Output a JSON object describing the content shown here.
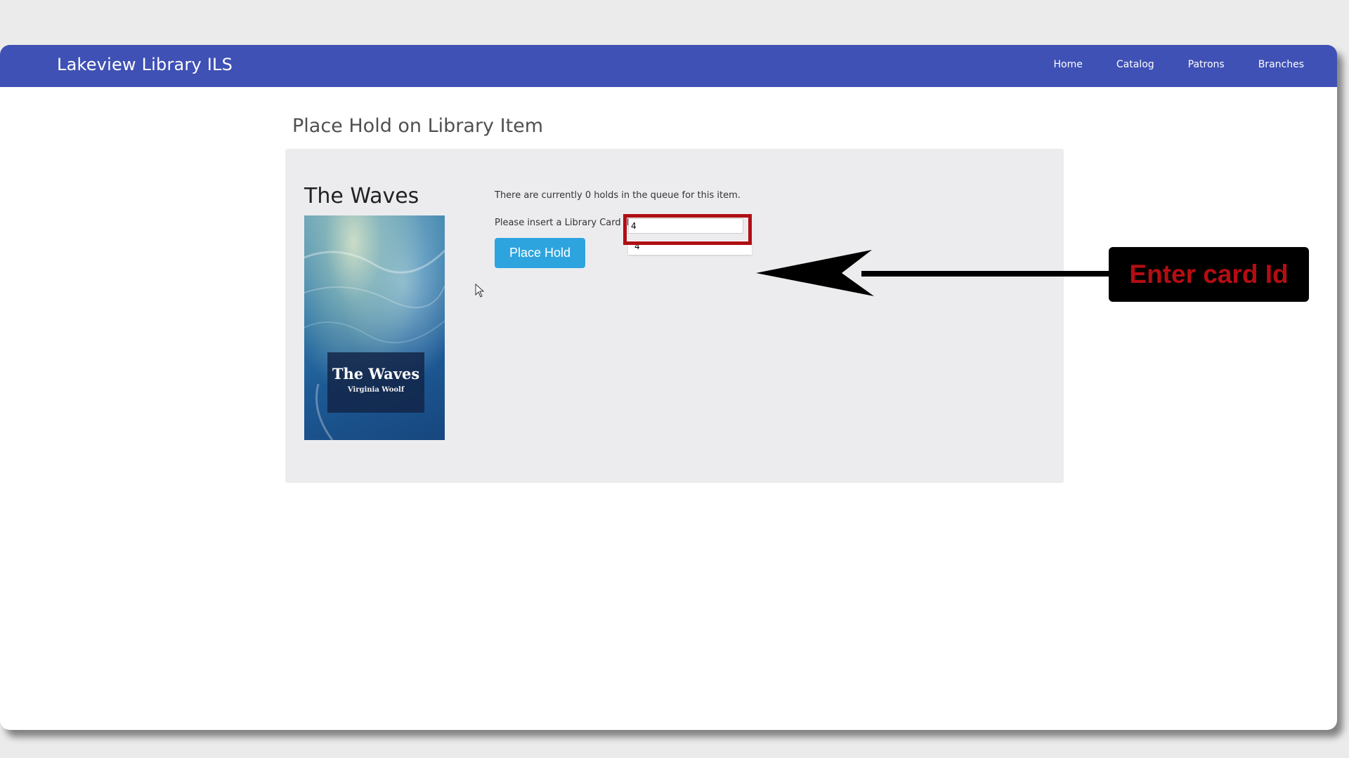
{
  "app": {
    "brand": "Lakeview Library ILS"
  },
  "nav": {
    "items": [
      {
        "label": "Home"
      },
      {
        "label": "Catalog"
      },
      {
        "label": "Patrons"
      },
      {
        "label": "Branches"
      }
    ]
  },
  "page": {
    "title": "Place Hold on Library Item"
  },
  "item": {
    "title": "The Waves",
    "cover": {
      "title": "The Waves",
      "author": "Virginia Woolf",
      "icon": "book-cover-image"
    }
  },
  "hold_form": {
    "queue_text": "There are currently 0 holds in the queue for this item.",
    "card_label": "Please insert a Library Card ID:",
    "card_value": "4",
    "autocomplete_suggestion": "4",
    "submit_label": "Place Hold"
  },
  "annotation": {
    "callout_text": "Enter card Id",
    "highlight_color": "#b00f14",
    "callout_text_color": "#b50d12",
    "callout_background": "#000000",
    "arrow_icon": "arrow-left-icon"
  },
  "colors": {
    "navbar": "#3f51b5",
    "button": "#2ea4df",
    "panel": "#ececef"
  }
}
